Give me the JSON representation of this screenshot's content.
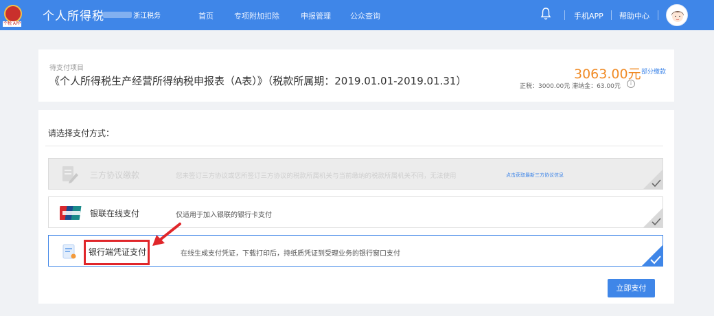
{
  "header": {
    "logo_caption": "个税 APP",
    "app_title": "个人所得税",
    "region": "浙江税务",
    "nav": [
      {
        "label": "首页"
      },
      {
        "label": "专项附加扣除"
      },
      {
        "label": "申报管理"
      },
      {
        "label": "公众查询"
      }
    ],
    "mobile_app": "手机APP",
    "help_center": "帮助中心",
    "colors": {
      "bar": "#3f86e8"
    }
  },
  "summary": {
    "label": "待支付项目",
    "title": "《个人所得税生产经营所得纳税申报表（A表）》（税款所属期：2019.01.01-2019.01.31）",
    "amount": "3063.00元",
    "partial_link": "部分缴款",
    "breakdown": "正税：3000.00元    滞纳金：63.00元",
    "amount_color": "#f08a24"
  },
  "payment": {
    "prompt": "请选择支付方式：",
    "options": [
      {
        "name": "三方协议缴款",
        "desc": "您未签订三方协议或您所签订三方协议的税款所属机关与当前缴纳的税款所属机关不同，无法使用",
        "link": "点击获取最新三方协议信息",
        "state": "disabled",
        "icon": "document-edit-icon"
      },
      {
        "name": "银联在线支付",
        "desc": "仅适用于加入银联的银行卡支付",
        "state": "available",
        "icon": "unionpay-icon"
      },
      {
        "name": "银行端凭证支付",
        "desc": "在线生成支付凭证，下载打印后，持纸质凭证到受理业务的银行窗口支付",
        "state": "selected",
        "icon": "voucher-icon"
      }
    ],
    "pay_button": "立即支付"
  }
}
